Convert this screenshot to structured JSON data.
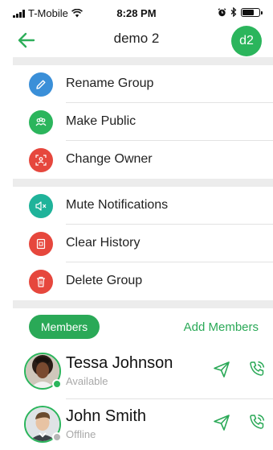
{
  "status_bar": {
    "carrier": "T-Mobile",
    "time": "8:28 PM"
  },
  "header": {
    "title": "demo 2",
    "avatar_initials": "d2",
    "back_icon": "arrow-left-icon"
  },
  "colors": {
    "accent": "#2aa957",
    "blue": "#3a8fd8",
    "green": "#2bb55c",
    "red": "#e6473d",
    "teal": "#1fb39a"
  },
  "menu": {
    "group_settings": [
      {
        "label": "Rename Group",
        "icon": "pencil-icon"
      },
      {
        "label": "Make Public",
        "icon": "people-icon"
      },
      {
        "label": "Change Owner",
        "icon": "change-owner-icon"
      }
    ],
    "group_actions": [
      {
        "label": "Mute Notifications",
        "icon": "speaker-mute-icon"
      },
      {
        "label": "Clear History",
        "icon": "clear-history-icon"
      },
      {
        "label": "Delete Group",
        "icon": "trash-icon"
      }
    ]
  },
  "members_section": {
    "tab_label": "Members",
    "add_label": "Add Members",
    "members": [
      {
        "name": "Tessa Johnson",
        "status": "Available",
        "presence": "online"
      },
      {
        "name": "John Smith",
        "status": "Offline",
        "presence": "offline"
      }
    ]
  }
}
